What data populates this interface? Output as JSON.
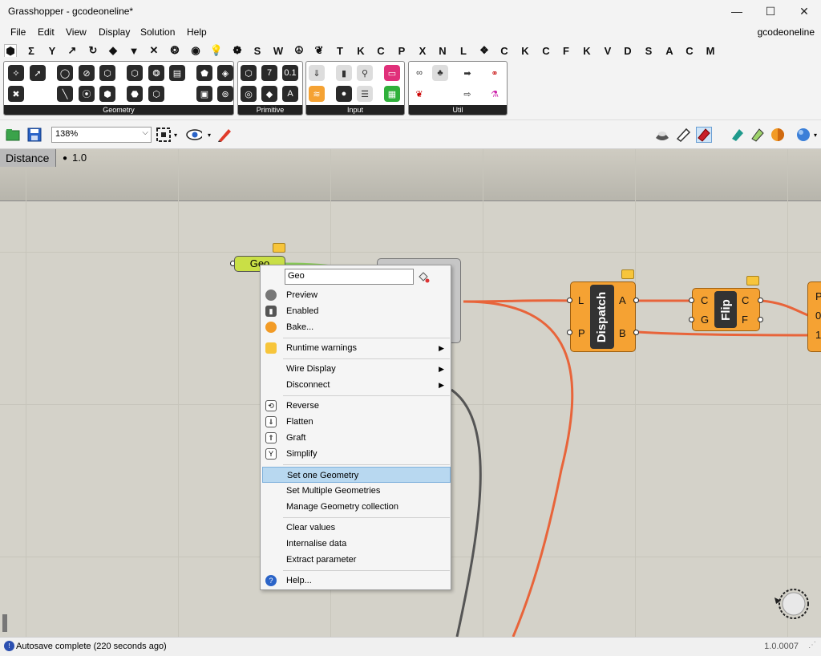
{
  "window": {
    "title": "Grasshopper - gcodeoneline*",
    "minimize": "—",
    "maximize": "☐",
    "close": "✕"
  },
  "menu": {
    "items": [
      "File",
      "Edit",
      "View",
      "Display",
      "Solution",
      "Help"
    ],
    "document_name": "gcodeoneline"
  },
  "tabs": {
    "letters": [
      "S",
      "W",
      "T",
      "K",
      "C",
      "P",
      "X",
      "N",
      "L",
      "C",
      "K",
      "C",
      "F",
      "K",
      "V",
      "D",
      "S",
      "A",
      "C",
      "M"
    ]
  },
  "ribbon": {
    "panels": [
      "Geometry",
      "Primitive",
      "Input",
      "Util"
    ]
  },
  "toolbar": {
    "zoom": "138%"
  },
  "canvas": {
    "geo_node_label": "Geo",
    "distance_label": "Distance",
    "distance_value": "1.0",
    "dispatch_label": "Dispatch",
    "dispatch_inputs": [
      "L",
      "P"
    ],
    "dispatch_outputs": [
      "A",
      "B"
    ],
    "flip_label": "Flip",
    "flip_inputs": [
      "C",
      "G"
    ],
    "flip_outputs": [
      "C",
      "F"
    ],
    "right_node_ports": [
      "P",
      "0",
      "1"
    ]
  },
  "context_menu": {
    "name_field": "Geo",
    "items": [
      {
        "label": "Preview",
        "icon": "preview-icon"
      },
      {
        "label": "Enabled",
        "icon": "enabled-icon"
      },
      {
        "label": "Bake...",
        "icon": "bake-icon"
      },
      {
        "label": "Runtime warnings",
        "icon": "warning-icon",
        "submenu": true
      },
      {
        "label": "Wire Display",
        "submenu": true
      },
      {
        "label": "Disconnect",
        "submenu": true
      },
      {
        "label": "Reverse",
        "icon": "reverse-icon"
      },
      {
        "label": "Flatten",
        "icon": "flatten-icon"
      },
      {
        "label": "Graft",
        "icon": "graft-icon"
      },
      {
        "label": "Simplify",
        "icon": "simplify-icon"
      },
      {
        "label": "Set one Geometry",
        "highlighted": true
      },
      {
        "label": "Set Multiple Geometries"
      },
      {
        "label": "Manage Geometry collection"
      },
      {
        "label": "Clear values"
      },
      {
        "label": "Internalise data"
      },
      {
        "label": "Extract parameter"
      },
      {
        "label": "Help...",
        "icon": "help-icon"
      }
    ]
  },
  "status": {
    "message": "Autosave complete (220 seconds ago)",
    "version": "1.0.0007"
  }
}
